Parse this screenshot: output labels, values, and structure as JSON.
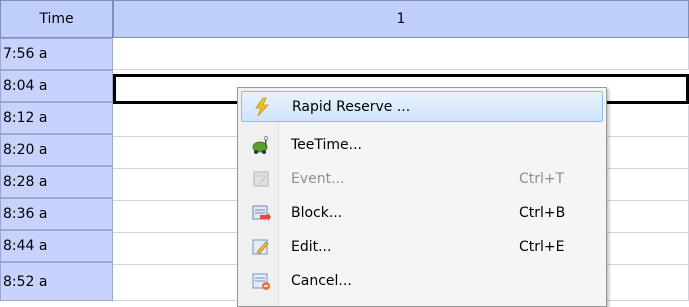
{
  "table": {
    "time_header": "Time",
    "column_header": "1",
    "times": [
      "7:56 a",
      "8:04 a",
      "8:12 a",
      "8:20 a",
      "8:28 a",
      "8:36 a",
      "8:44 a",
      "8:52 a"
    ],
    "selected_time": "8:04 a"
  },
  "context_menu": {
    "items": [
      {
        "label": "Rapid Reserve ...",
        "shortcut": "",
        "icon": "lightning-icon",
        "enabled": true,
        "highlighted": true
      },
      {
        "label": "TeeTime...",
        "shortcut": "",
        "icon": "golf-cart-icon",
        "enabled": true,
        "highlighted": false
      },
      {
        "label": "Event...",
        "shortcut": "Ctrl+T",
        "icon": "event-icon",
        "enabled": false,
        "highlighted": false
      },
      {
        "label": "Block...",
        "shortcut": "Ctrl+B",
        "icon": "block-icon",
        "enabled": true,
        "highlighted": false
      },
      {
        "label": "Edit...",
        "shortcut": "Ctrl+E",
        "icon": "edit-icon",
        "enabled": true,
        "highlighted": false
      },
      {
        "label": "Cancel...",
        "shortcut": "",
        "icon": "cancel-icon",
        "enabled": true,
        "highlighted": false
      }
    ]
  },
  "colors": {
    "header_bg": "#c0cffa",
    "time_cell_bg": "#c7d3fb",
    "menu_highlight": "#cfe4fb"
  }
}
